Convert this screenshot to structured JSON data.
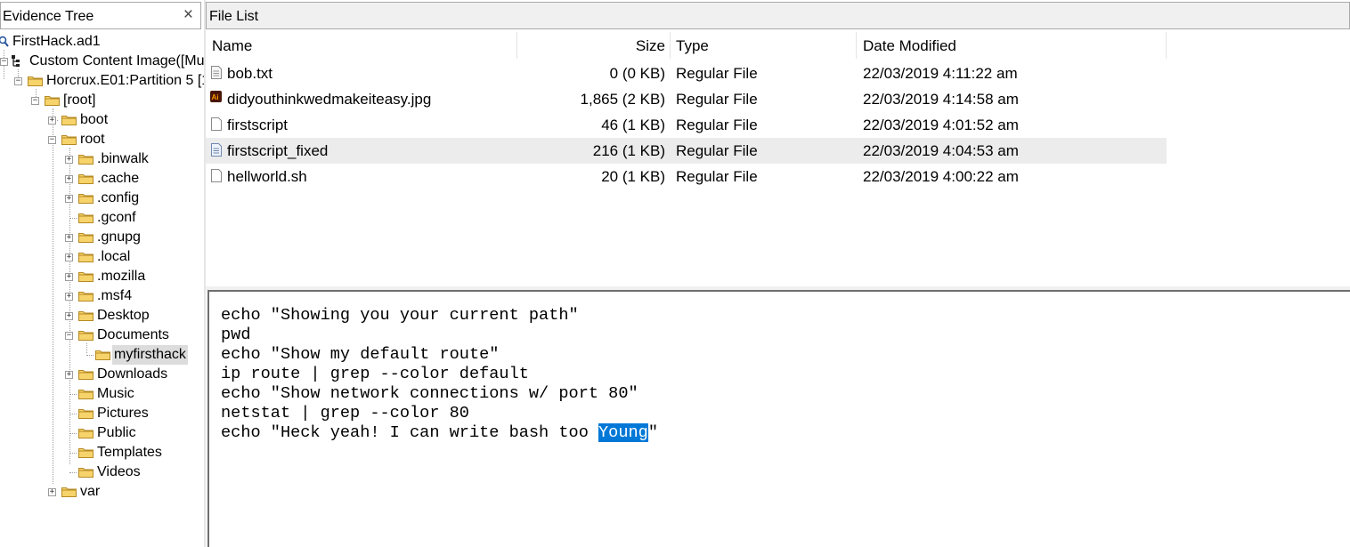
{
  "evidence_tree": {
    "title": "Evidence Tree",
    "close_glyph": "×",
    "items": [
      {
        "label": "FirstHack.ad1"
      },
      {
        "label": "Custom Content Image([Mu"
      },
      {
        "label": "Horcrux.E01:Partition 5 [1"
      },
      {
        "label": "[root]"
      },
      {
        "label": "boot"
      },
      {
        "label": "root"
      },
      {
        "label": ".binwalk"
      },
      {
        "label": ".cache"
      },
      {
        "label": ".config"
      },
      {
        "label": ".gconf"
      },
      {
        "label": ".gnupg"
      },
      {
        "label": ".local"
      },
      {
        "label": ".mozilla"
      },
      {
        "label": ".msf4"
      },
      {
        "label": "Desktop"
      },
      {
        "label": "Documents"
      },
      {
        "label": "myfirsthack"
      },
      {
        "label": "Downloads"
      },
      {
        "label": "Music"
      },
      {
        "label": "Pictures"
      },
      {
        "label": "Public"
      },
      {
        "label": "Templates"
      },
      {
        "label": "Videos"
      },
      {
        "label": "var"
      }
    ]
  },
  "file_list": {
    "title": "File List",
    "columns": {
      "name": "Name",
      "size": "Size",
      "type": "Type",
      "date": "Date Modified"
    },
    "rows": [
      {
        "name": "bob.txt",
        "size": "0 (0 KB)",
        "type": "Regular File",
        "date": "22/03/2019 4:11:22 am",
        "icon": "text-file-icon"
      },
      {
        "name": "didyouthinkwedmakeiteasy.jpg",
        "size": "1,865 (2 KB)",
        "type": "Regular File",
        "date": "22/03/2019 4:14:58 am",
        "icon": "illustrator-image-icon"
      },
      {
        "name": "firstscript",
        "size": "46 (1 KB)",
        "type": "Regular File",
        "date": "22/03/2019 4:01:52 am",
        "icon": "blank-file-icon"
      },
      {
        "name": "firstscript_fixed",
        "size": "216 (1 KB)",
        "type": "Regular File",
        "date": "22/03/2019 4:04:53 am",
        "icon": "script-file-icon"
      },
      {
        "name": "hellworld.sh",
        "size": "20 (1 KB)",
        "type": "Regular File",
        "date": "22/03/2019 4:00:22 am",
        "icon": "blank-file-icon"
      }
    ]
  },
  "viewer": {
    "lines": [
      "echo \"Showing you your current path\"",
      "pwd",
      "echo \"Show my default route\"",
      "ip route | grep --color default",
      "echo \"Show network connections w/ port 80\"",
      "netstat | grep --color 80"
    ],
    "last_line_before": "echo \"Heck yeah! I can write bash too ",
    "last_line_highlight": "Young",
    "last_line_after": "\"",
    "highlight_color": "#0078d7"
  }
}
